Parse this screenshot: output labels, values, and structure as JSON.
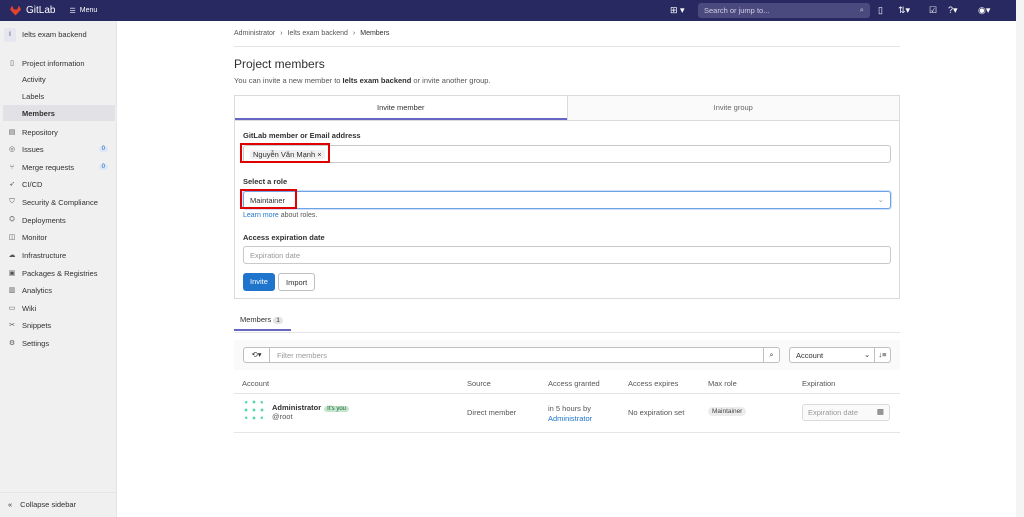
{
  "topbar": {
    "brand": "GitLab",
    "menu": "Menu",
    "search_placeholder": "Search or jump to..."
  },
  "sidebar": {
    "project": "Ielts exam backend",
    "project_initial": "I",
    "items": [
      {
        "label": "Project information",
        "icon": "info-icon"
      },
      {
        "label": "Activity",
        "sub": true
      },
      {
        "label": "Labels",
        "sub": true
      },
      {
        "label": "Members",
        "sub": true,
        "active": true
      },
      {
        "label": "Repository",
        "icon": "repo-icon"
      },
      {
        "label": "Issues",
        "icon": "issues-icon",
        "badge": "0"
      },
      {
        "label": "Merge requests",
        "icon": "merge-icon",
        "badge": "0"
      },
      {
        "label": "CI/CD",
        "icon": "rocket-icon"
      },
      {
        "label": "Security & Compliance",
        "icon": "shield-icon"
      },
      {
        "label": "Deployments",
        "icon": "deploy-icon"
      },
      {
        "label": "Monitor",
        "icon": "monitor-icon"
      },
      {
        "label": "Infrastructure",
        "icon": "cloud-icon"
      },
      {
        "label": "Packages & Registries",
        "icon": "package-icon"
      },
      {
        "label": "Analytics",
        "icon": "chart-icon"
      },
      {
        "label": "Wiki",
        "icon": "book-icon"
      },
      {
        "label": "Snippets",
        "icon": "snippet-icon"
      },
      {
        "label": "Settings",
        "icon": "gear-icon"
      }
    ],
    "collapse": "Collapse sidebar"
  },
  "breadcrumb": [
    "Administrator",
    "Ielts exam backend",
    "Members"
  ],
  "page": {
    "title": "Project members",
    "subtitle_pre": "You can invite a new member to ",
    "subtitle_project": "Ielts exam backend",
    "subtitle_post": " or invite another group."
  },
  "invite": {
    "tabs": [
      "Invite member",
      "Invite group"
    ],
    "member_label": "GitLab member or Email address",
    "member_chip": "Nguyễn Văn Mạnh",
    "chip_remove": "×",
    "role_label": "Select a role",
    "role_value": "Maintainer",
    "learn_more": "Learn more",
    "learn_more_post": " about roles.",
    "expiration_label": "Access expiration date",
    "expiration_placeholder": "Expiration date",
    "invite_button": "Invite",
    "import_button": "Import"
  },
  "members": {
    "tab": "Members",
    "count": "1",
    "filter_placeholder": "Filter members",
    "sort": "Account",
    "columns": [
      "Account",
      "Source",
      "Access granted",
      "Access expires",
      "Max role",
      "Expiration"
    ],
    "rows": [
      {
        "name": "Administrator",
        "badge": "It's you",
        "username": "@root",
        "source": "Direct member",
        "granted": "in 5 hours by",
        "granted_by": "Administrator",
        "expires": "No expiration set",
        "role": "Maintainer",
        "expiration_placeholder": "Expiration date"
      }
    ]
  }
}
